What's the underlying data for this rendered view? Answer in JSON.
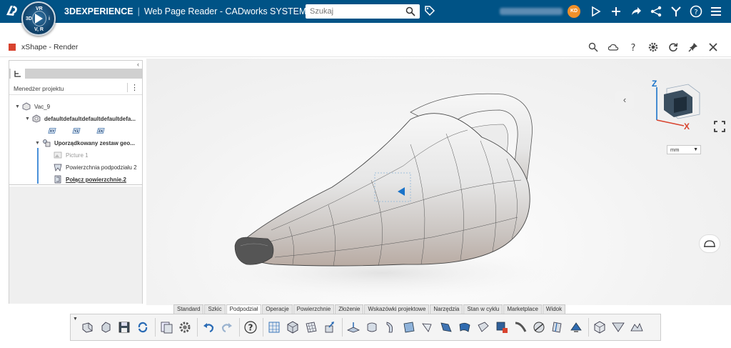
{
  "topbar": {
    "brand": "3DEXPERIENCE",
    "app_name": "Web Page Reader - CADworks SYSTEMS",
    "search_placeholder": "Szukaj",
    "avatar_initials": "KD",
    "compass": {
      "top": "VR",
      "left": "3D",
      "right": "i",
      "bottom": "V, R"
    }
  },
  "app": {
    "title": "xShape - Render"
  },
  "panel": {
    "manager_label": "Menedżer projektu",
    "tree": [
      {
        "label": "Vac_9"
      },
      {
        "label": "defaultdefaultdefaultdefaultdefa..."
      },
      {
        "label": "Uporządkowany zestaw geo..."
      },
      {
        "label": "Picture 1"
      },
      {
        "label": "Powierzchnia podpodziału 2"
      },
      {
        "label": "Połącz powierzchnie.2"
      }
    ],
    "planes": [
      "XY",
      "YZ",
      "ZX"
    ]
  },
  "viewport": {
    "units": "mm",
    "axis_labels": {
      "z": "Z",
      "x": "X"
    }
  },
  "action_tabs": [
    "Standard",
    "Szkic",
    "Podpodział",
    "Operacje",
    "Powierzchnie",
    "Złożenie",
    "Wskazówki projektowe",
    "Narzędzia",
    "Stan w cyklu",
    "Marketplace",
    "Widok"
  ],
  "active_tab": "Podpodział",
  "colors": {
    "topbar": "#005386",
    "accent": "#d8432e",
    "avatar": "#f0902a",
    "axis": "#1a73c9"
  }
}
